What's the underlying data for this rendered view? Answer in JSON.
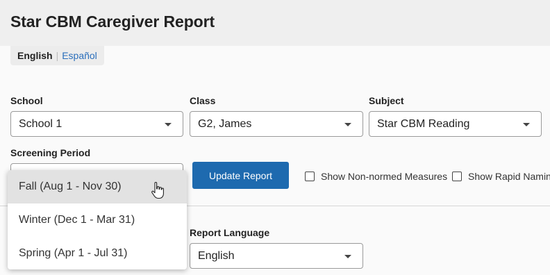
{
  "header": {
    "title": "Star CBM Caregiver Report"
  },
  "language_switch": {
    "active": "English",
    "separator": "|",
    "alternate": "Español"
  },
  "filters": {
    "school": {
      "label": "School",
      "value": "School 1"
    },
    "class": {
      "label": "Class",
      "value": "G2, James"
    },
    "subject": {
      "label": "Subject",
      "value": "Star CBM Reading"
    },
    "screening_period": {
      "label": "Screening Period",
      "options": [
        "Fall (Aug 1 - Nov 30)",
        "Winter (Dec 1 - Mar 31)",
        "Spring (Apr 1 - Jul 31)"
      ],
      "hovered_index": 0
    }
  },
  "actions": {
    "update_label": "Update Report"
  },
  "checkboxes": {
    "non_normed": {
      "label": "Show Non-normed Measures",
      "checked": false
    },
    "rapid_naming": {
      "label": "Show Rapid Namin",
      "checked": false
    }
  },
  "report_language": {
    "label": "Report Language",
    "value": "English"
  },
  "colors": {
    "primary": "#1e6aaf",
    "link": "#2a6ebb",
    "header_bg": "#efefef"
  }
}
